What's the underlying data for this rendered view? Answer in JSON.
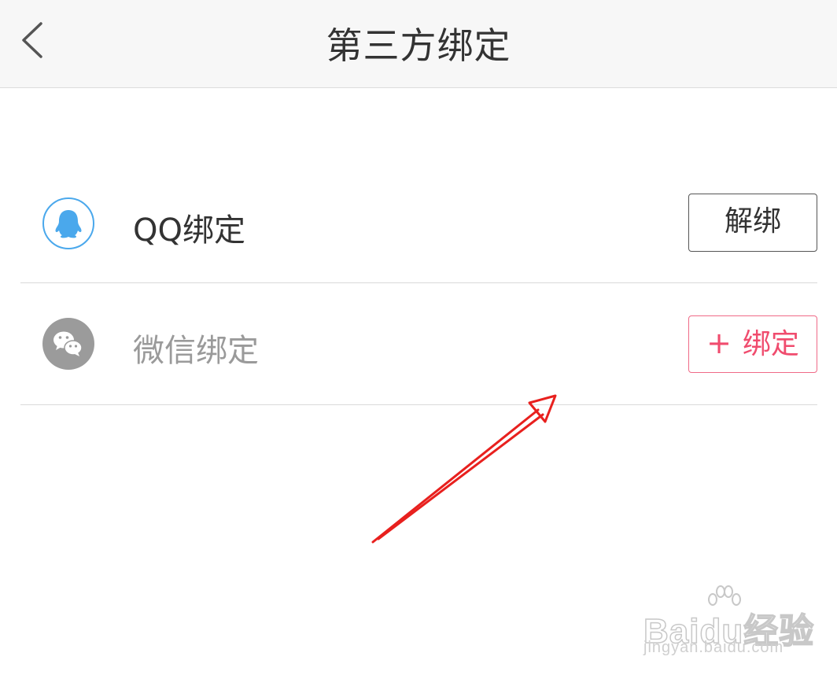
{
  "header": {
    "title": "第三方绑定",
    "back_icon": "chevron-left-icon"
  },
  "bindings": [
    {
      "label": "QQ绑定",
      "icon": "qq-icon",
      "icon_color": "#4aa8ec",
      "bound": true,
      "action_label": "解绑"
    },
    {
      "label": "微信绑定",
      "icon": "wechat-icon",
      "icon_color": "#9b9b9b",
      "bound": false,
      "action_icon": "+",
      "action_label": "绑定",
      "action_color": "#f04c6e"
    }
  ],
  "annotation": {
    "arrow_color": "#e8201e"
  },
  "watermark": {
    "brand": "Baidu经验",
    "url": "jingyan.baidu.com"
  }
}
